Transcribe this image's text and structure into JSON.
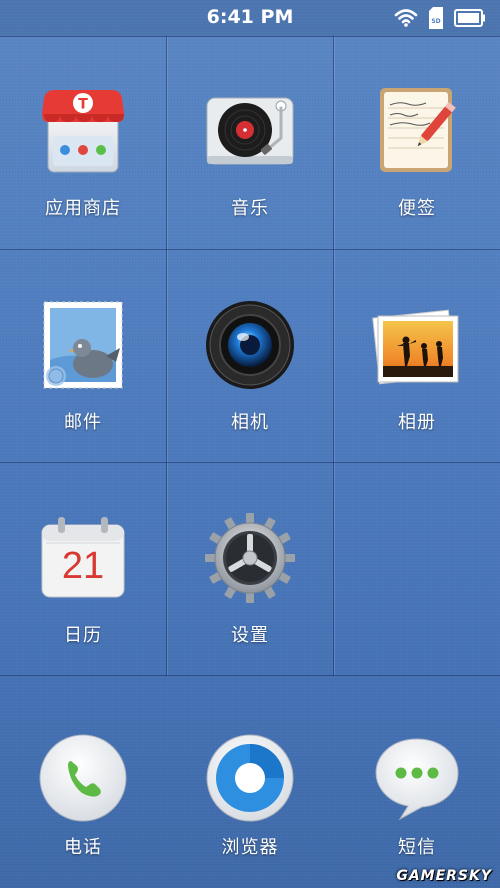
{
  "status_bar": {
    "time": "6:41 PM",
    "icons": [
      "wifi-icon",
      "sd-card-icon",
      "battery-icon"
    ],
    "sd_label": "SD"
  },
  "apps": [
    {
      "label": "应用商店",
      "icon": "app-store-icon"
    },
    {
      "label": "音乐",
      "icon": "music-icon"
    },
    {
      "label": "便签",
      "icon": "notes-icon"
    },
    {
      "label": "邮件",
      "icon": "mail-icon"
    },
    {
      "label": "相机",
      "icon": "camera-icon"
    },
    {
      "label": "相册",
      "icon": "gallery-icon"
    },
    {
      "label": "日历",
      "icon": "calendar-icon"
    },
    {
      "label": "设置",
      "icon": "settings-icon"
    }
  ],
  "calendar_day": "21",
  "store_badge": "T",
  "dock": [
    {
      "label": "电话",
      "icon": "phone-icon"
    },
    {
      "label": "浏览器",
      "icon": "browser-icon"
    },
    {
      "label": "短信",
      "icon": "sms-icon"
    }
  ],
  "watermark": "GAMERSKY",
  "colors": {
    "background": "#4f7dbf",
    "grid_line": "#2a4a80",
    "label": "#ffffff"
  }
}
